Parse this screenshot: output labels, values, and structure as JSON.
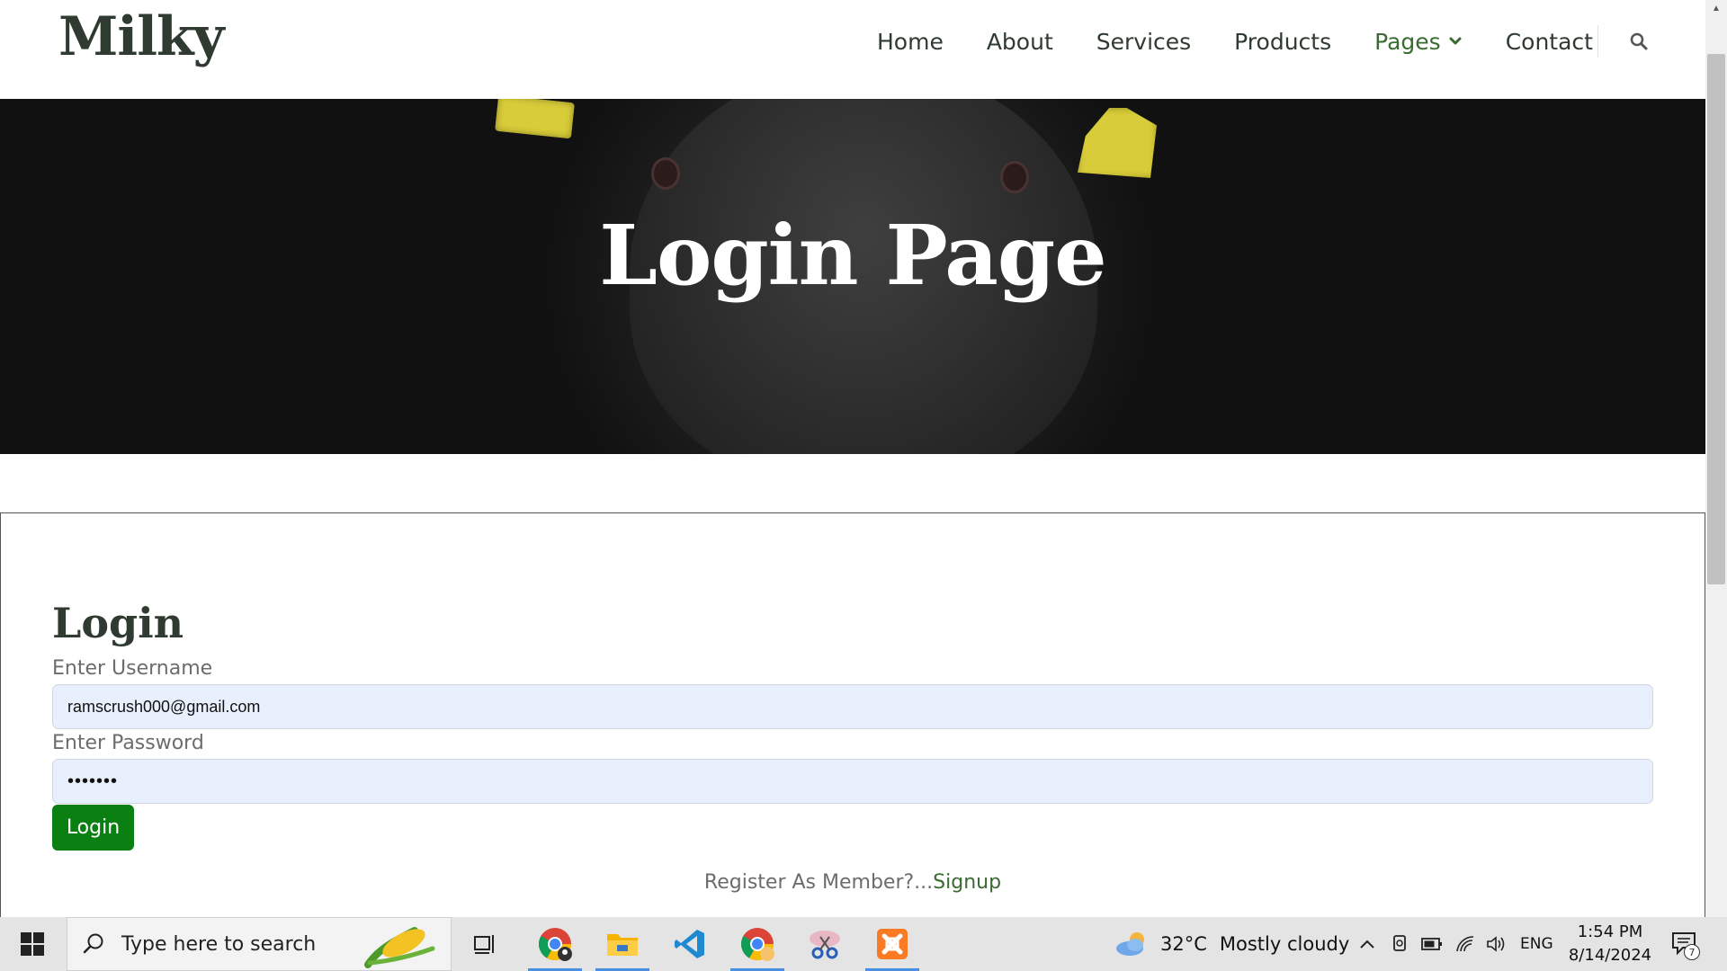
{
  "header": {
    "brand": "Milky",
    "nav": [
      "Home",
      "About",
      "Services",
      "Products",
      "Pages",
      "Contact"
    ],
    "active_item": "Pages",
    "search_icon": "search-icon",
    "dropdown_icon": "chevron-down-icon"
  },
  "hero": {
    "title": "Login Page"
  },
  "login": {
    "title": "Login",
    "username_label": "Enter Username",
    "username_value": "ramscrush000@gmail.com",
    "password_label": "Enter Password",
    "password_value": "•••••••",
    "button_label": "Login",
    "register_text": "Register As Member?...",
    "signup_link": "Signup"
  },
  "taskbar": {
    "search_placeholder": "Type here to search",
    "apps": [
      "task-view-icon",
      "chrome-profile-icon",
      "file-explorer-icon",
      "vscode-icon",
      "chrome-icon",
      "snipping-tool-icon",
      "xampp-icon"
    ],
    "weather_temp": "32°C",
    "weather_desc": "Mostly cloudy",
    "language": "ENG",
    "time": "1:54 PM",
    "date": "8/14/2024",
    "notification_count": "7"
  },
  "colors": {
    "brand_green": "#3a6b32",
    "button_green": "#0a7f12",
    "input_bg": "#e8f0fe",
    "heading": "#2f3b31"
  }
}
